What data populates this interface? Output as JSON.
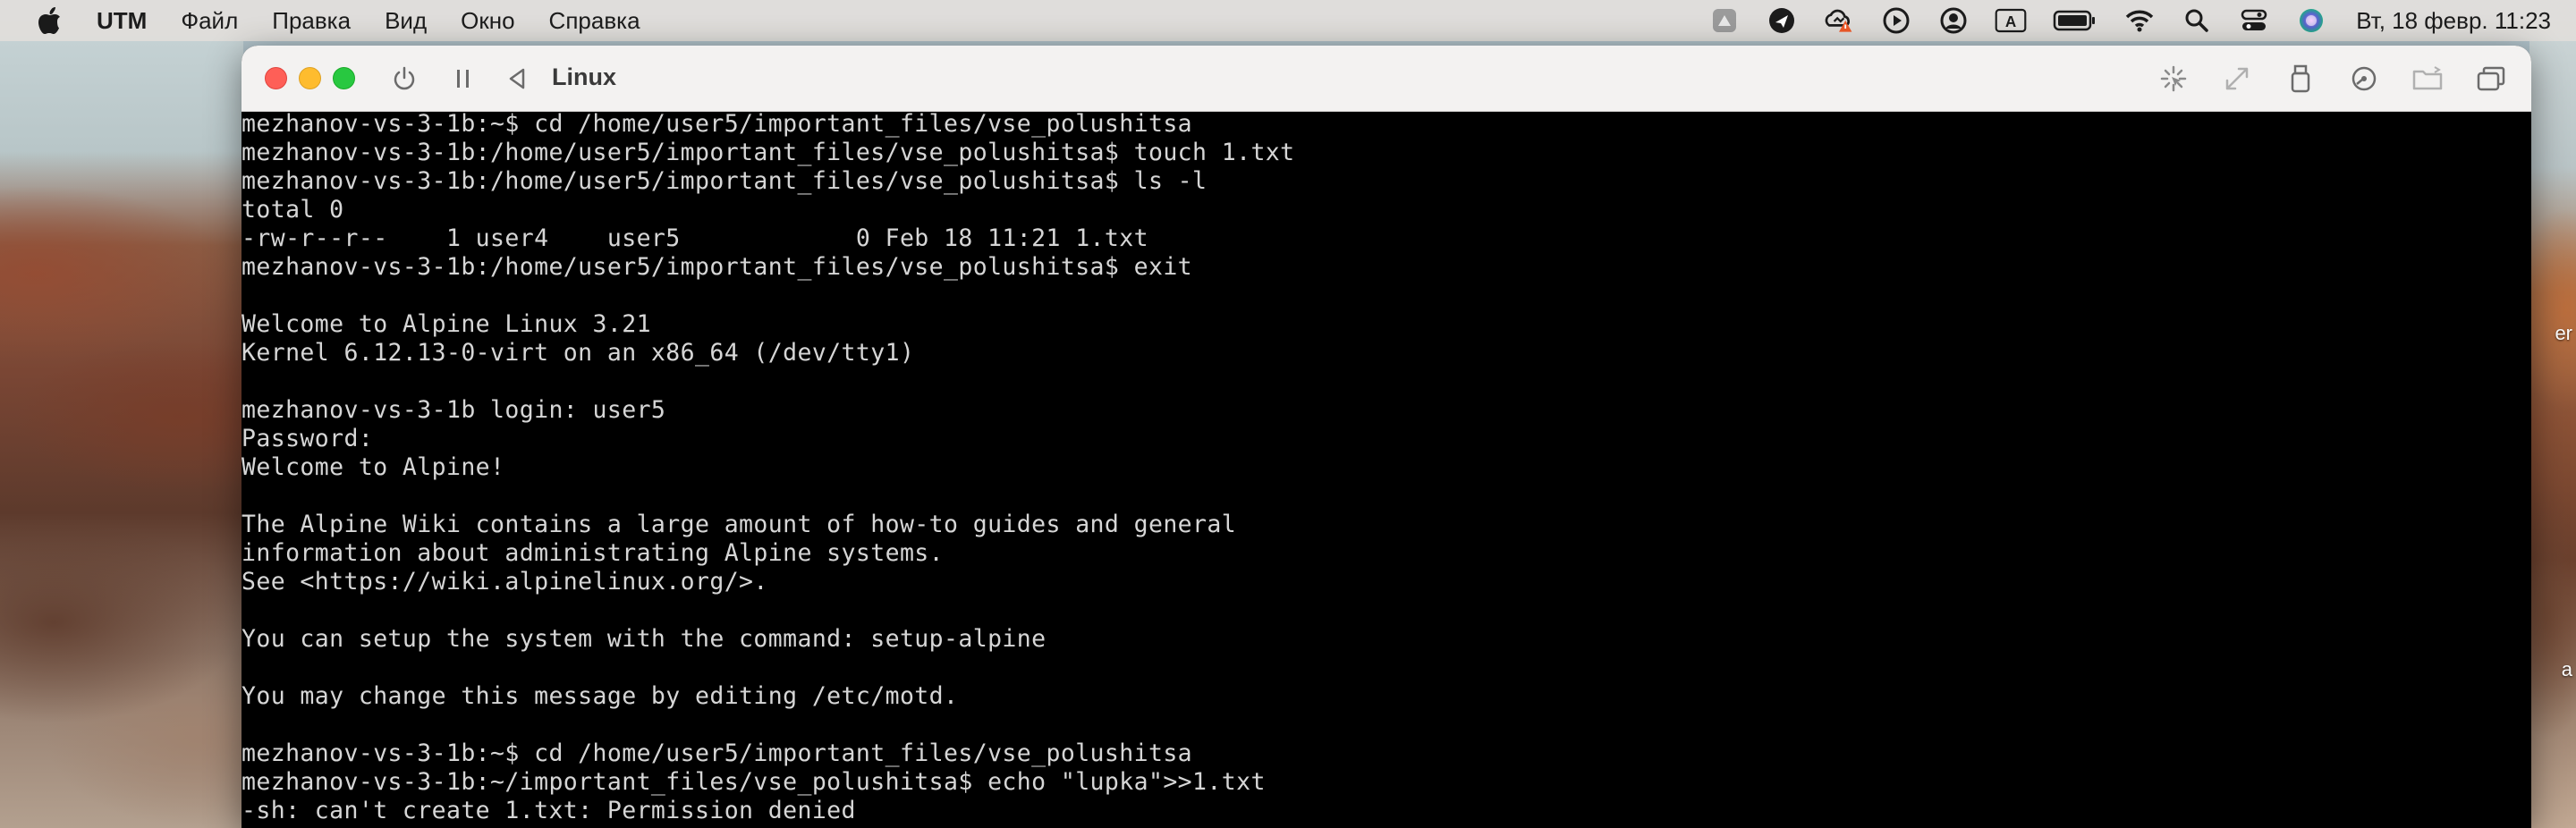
{
  "menubar": {
    "app_name": "UTM",
    "items": [
      "Файл",
      "Правка",
      "Вид",
      "Окно",
      "Справка"
    ],
    "clock": "Вт, 18 февр.  11:23",
    "status_icons": [
      "drive-icon",
      "mail-arrow-icon",
      "cloud-warning-icon",
      "play-circle-icon",
      "user-circle-icon",
      "input-source-a-icon",
      "battery-icon",
      "wifi-icon",
      "search-icon",
      "control-center-icon",
      "siri-icon"
    ],
    "input_source_label": "A"
  },
  "window": {
    "title": "Linux",
    "toolbar_icons": [
      "power-icon",
      "pause-icon",
      "back-icon",
      "cursor-capture-icon",
      "resize-icon",
      "usb-icon",
      "disk-icon",
      "shared-folder-icon",
      "windows-icon"
    ]
  },
  "desktop": {
    "right_labels": [
      "er",
      "a"
    ]
  },
  "terminal": {
    "lines": [
      "mezhanov-vs-3-1b:~$ cd /home/user5/important_files/vse_polushitsa",
      "mezhanov-vs-3-1b:/home/user5/important_files/vse_polushitsa$ touch 1.txt",
      "mezhanov-vs-3-1b:/home/user5/important_files/vse_polushitsa$ ls -l",
      "total 0",
      "-rw-r--r--    1 user4    user5            0 Feb 18 11:21 1.txt",
      "mezhanov-vs-3-1b:/home/user5/important_files/vse_polushitsa$ exit",
      "",
      "Welcome to Alpine Linux 3.21",
      "Kernel 6.12.13-0-virt on an x86_64 (/dev/tty1)",
      "",
      "mezhanov-vs-3-1b login: user5",
      "Password:",
      "Welcome to Alpine!",
      "",
      "The Alpine Wiki contains a large amount of how-to guides and general",
      "information about administrating Alpine systems.",
      "See <https://wiki.alpinelinux.org/>.",
      "",
      "You can setup the system with the command: setup-alpine",
      "",
      "You may change this message by editing /etc/motd.",
      "",
      "mezhanov-vs-3-1b:~$ cd /home/user5/important_files/vse_polushitsa",
      "mezhanov-vs-3-1b:~/important_files/vse_polushitsa$ echo \"lupka\">>1.txt",
      "-sh: can't create 1.txt: Permission denied"
    ]
  }
}
